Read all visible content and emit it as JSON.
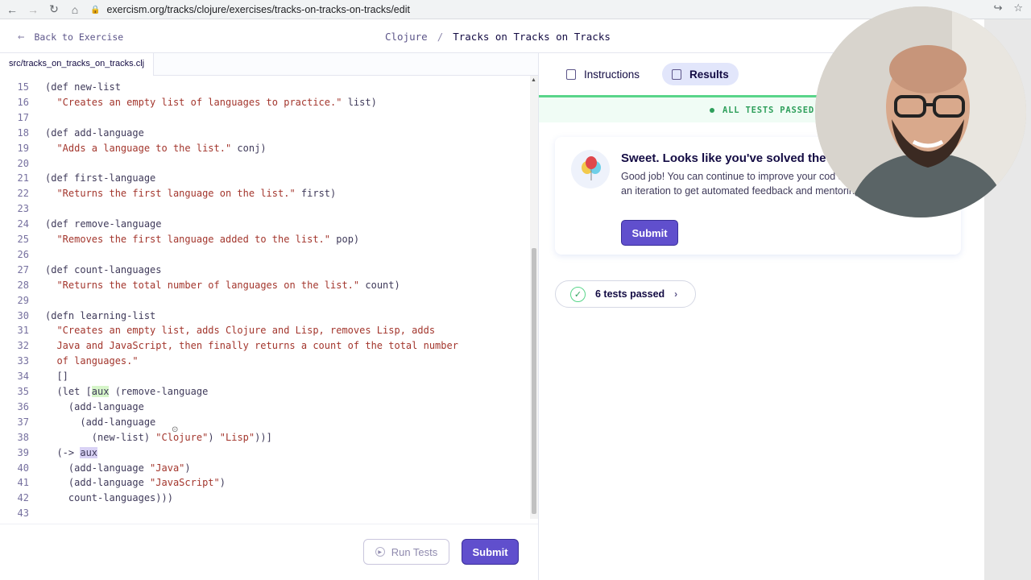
{
  "browser": {
    "url": "exercism.org/tracks/clojure/exercises/tracks-on-tracks-on-tracks/edit",
    "back_icon": "arrow-left-icon",
    "forward_icon": "arrow-right-icon",
    "reload_icon": "reload-icon",
    "home_icon": "home-icon"
  },
  "header": {
    "back_label": "Back to Exercise",
    "track": "Clojure",
    "separator": "/",
    "exercise": "Tracks on Tracks on Tracks"
  },
  "editor": {
    "file_tab": "src/tracks_on_tracks_on_tracks.clj",
    "lines": [
      {
        "n": "15",
        "code": "(def new-list"
      },
      {
        "n": "16",
        "code": "  \"Creates an empty list of languages to practice.\" list)"
      },
      {
        "n": "17",
        "code": ""
      },
      {
        "n": "18",
        "code": "(def add-language"
      },
      {
        "n": "19",
        "code": "  \"Adds a language to the list.\" conj)"
      },
      {
        "n": "20",
        "code": ""
      },
      {
        "n": "21",
        "code": "(def first-language"
      },
      {
        "n": "22",
        "code": "  \"Returns the first language on the list.\" first)"
      },
      {
        "n": "23",
        "code": ""
      },
      {
        "n": "24",
        "code": "(def remove-language"
      },
      {
        "n": "25",
        "code": "  \"Removes the first language added to the list.\" pop)"
      },
      {
        "n": "26",
        "code": ""
      },
      {
        "n": "27",
        "code": "(def count-languages"
      },
      {
        "n": "28",
        "code": "  \"Returns the total number of languages on the list.\" count)"
      },
      {
        "n": "29",
        "code": ""
      },
      {
        "n": "30",
        "code": "(defn learning-list"
      },
      {
        "n": "31",
        "code": "  \"Creates an empty list, adds Clojure and Lisp, removes Lisp, adds"
      },
      {
        "n": "32",
        "code": "  Java and JavaScript, then finally returns a count of the total number"
      },
      {
        "n": "33",
        "code": "  of languages.\""
      },
      {
        "n": "34",
        "code": "  []"
      },
      {
        "n": "35",
        "code": "  (let [aux (remove-language"
      },
      {
        "n": "36",
        "code": "    (add-language"
      },
      {
        "n": "37",
        "code": "      (add-language"
      },
      {
        "n": "38",
        "code": "        (new-list) \"Clojure\") \"Lisp\"))]"
      },
      {
        "n": "39",
        "code": "  (-> aux"
      },
      {
        "n": "40",
        "code": "    (add-language \"Java\")"
      },
      {
        "n": "41",
        "code": "    (add-language \"JavaScript\")"
      },
      {
        "n": "42",
        "code": "    count-languages)))"
      },
      {
        "n": "43",
        "code": ""
      }
    ]
  },
  "footer": {
    "run_tests_label": "Run Tests",
    "submit_label": "Submit"
  },
  "results": {
    "tabs": [
      {
        "label": "Instructions",
        "icon": "list-icon",
        "active": false
      },
      {
        "label": "Results",
        "icon": "results-icon",
        "active": true
      }
    ],
    "status": "ALL TESTS PASSED",
    "card_title": "Sweet. Looks like you've solved the",
    "card_text": "Good job! You can continue to improve your cod submit an iteration to get automated feedback and mentoring.",
    "card_submit_label": "Submit",
    "tests_passed_label": "6 tests passed",
    "colors": {
      "accent": "#604fcd",
      "success": "#59d58a",
      "string": "#a3362d"
    }
  }
}
